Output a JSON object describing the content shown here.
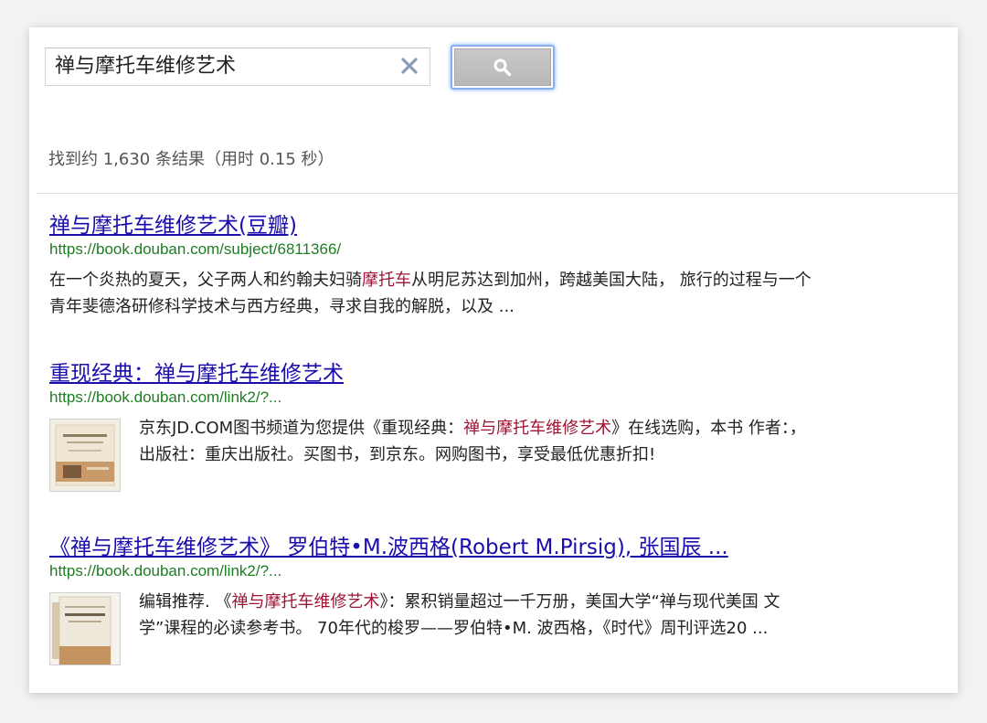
{
  "search": {
    "query": "禅与摩托车维修艺术",
    "clear_icon": "close-icon",
    "button_icon": "magnifier-icon"
  },
  "stats": "找到约 1,630 条结果（用时 0.15 秒）",
  "colors": {
    "link": "#1a0dab",
    "url": "#1e7d22",
    "highlight": "#a01332",
    "button_focus": "#8ab0ee"
  },
  "results": [
    {
      "title": "禅与摩托车维修艺术(豆瓣)",
      "url": "https://book.douban.com/subject/6811366/",
      "snippet_pre": "在一个炎热的夏天，父子两人和约翰夫妇骑",
      "snippet_hl": "摩托车",
      "snippet_post": "从明尼苏达到加州，跨越美国大陆， 旅行的过程与一个青年斐德洛研修科学技术与西方经典，寻求自我的解脱，以及 ..."
    },
    {
      "title": "重现经典：禅与摩托车维修艺术",
      "url": "https://book.douban.com/link2/?...",
      "snippet_pre": "京东JD.COM图书频道为您提供《重现经典：",
      "snippet_hl": "禅与摩托车维修艺术",
      "snippet_post": "》在线选购，本书 作者：，出版社：重庆出版社。买图书，到京东。网购图书，享受最低优惠折扣!"
    },
    {
      "title": "《禅与摩托车维修艺术》 罗伯特•M.波西格(Robert M.Pirsig), 张国辰 ...",
      "url": "https://book.douban.com/link2/?...",
      "snippet_pre": "编辑推荐. 《",
      "snippet_hl": "禅与摩托车维修艺术",
      "snippet_post": "》：累积销量超过一千万册，美国大学“禅与现代美国 文学”课程的必读参考书。 70年代的梭罗——罗伯特•M. 波西格，《时代》周刊评选20 ..."
    }
  ]
}
